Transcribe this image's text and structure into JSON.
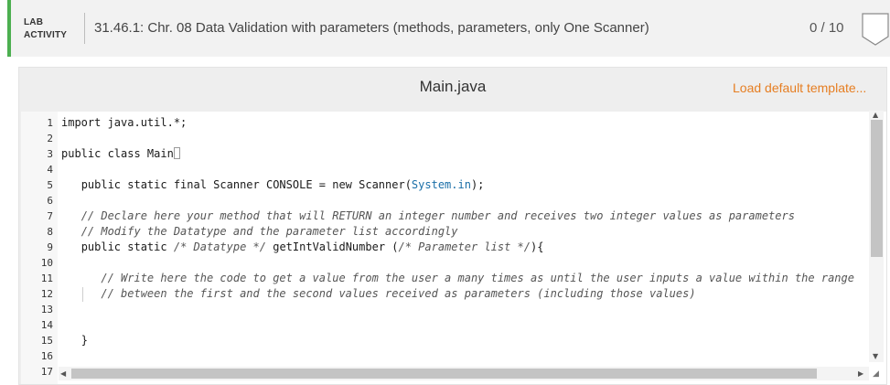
{
  "header": {
    "tag_line1": "LAB",
    "tag_line2": "ACTIVITY",
    "title": "31.46.1: Chr. 08 Data Validation with parameters (methods, parameters, only One Scanner)",
    "score": "0 / 10",
    "accent_color": "#4caf50"
  },
  "editor": {
    "file_name": "Main.java",
    "load_template_label": "Load default template...",
    "line_numbers": [
      "1",
      "2",
      "3",
      "4",
      "5",
      "6",
      "7",
      "8",
      "9",
      "10",
      "11",
      "12",
      "13",
      "14",
      "15",
      "16",
      "17"
    ],
    "lines": {
      "l1": "import java.util.*;",
      "l3": "public class Main",
      "l5a": "public static final Scanner CONSOLE = new Scanner(",
      "l5b": "System.in",
      "l5c": ");",
      "l7": "// Declare here your method that will RETURN an integer number and receives two integer values as parameters",
      "l8": "// Modify the Datatype and the parameter list accordingly",
      "l9a": "public static ",
      "l9b": "/* Datatype */",
      "l9c": " getIntValidNumber (",
      "l9d": "/* Parameter list */",
      "l9e": "){",
      "l11": "// Write here the code to get a value from the user a many times as until the user inputs a value within the range",
      "l12": "// between the first and the second values received as parameters (including those values)",
      "l15": "}"
    }
  },
  "icons": {
    "score_badge": "shield-badge-icon",
    "scroll_up": "chevron-up-icon",
    "scroll_down": "chevron-down-icon",
    "scroll_left": "chevron-left-icon",
    "scroll_right": "chevron-right-icon",
    "resize": "resize-grip-icon"
  }
}
